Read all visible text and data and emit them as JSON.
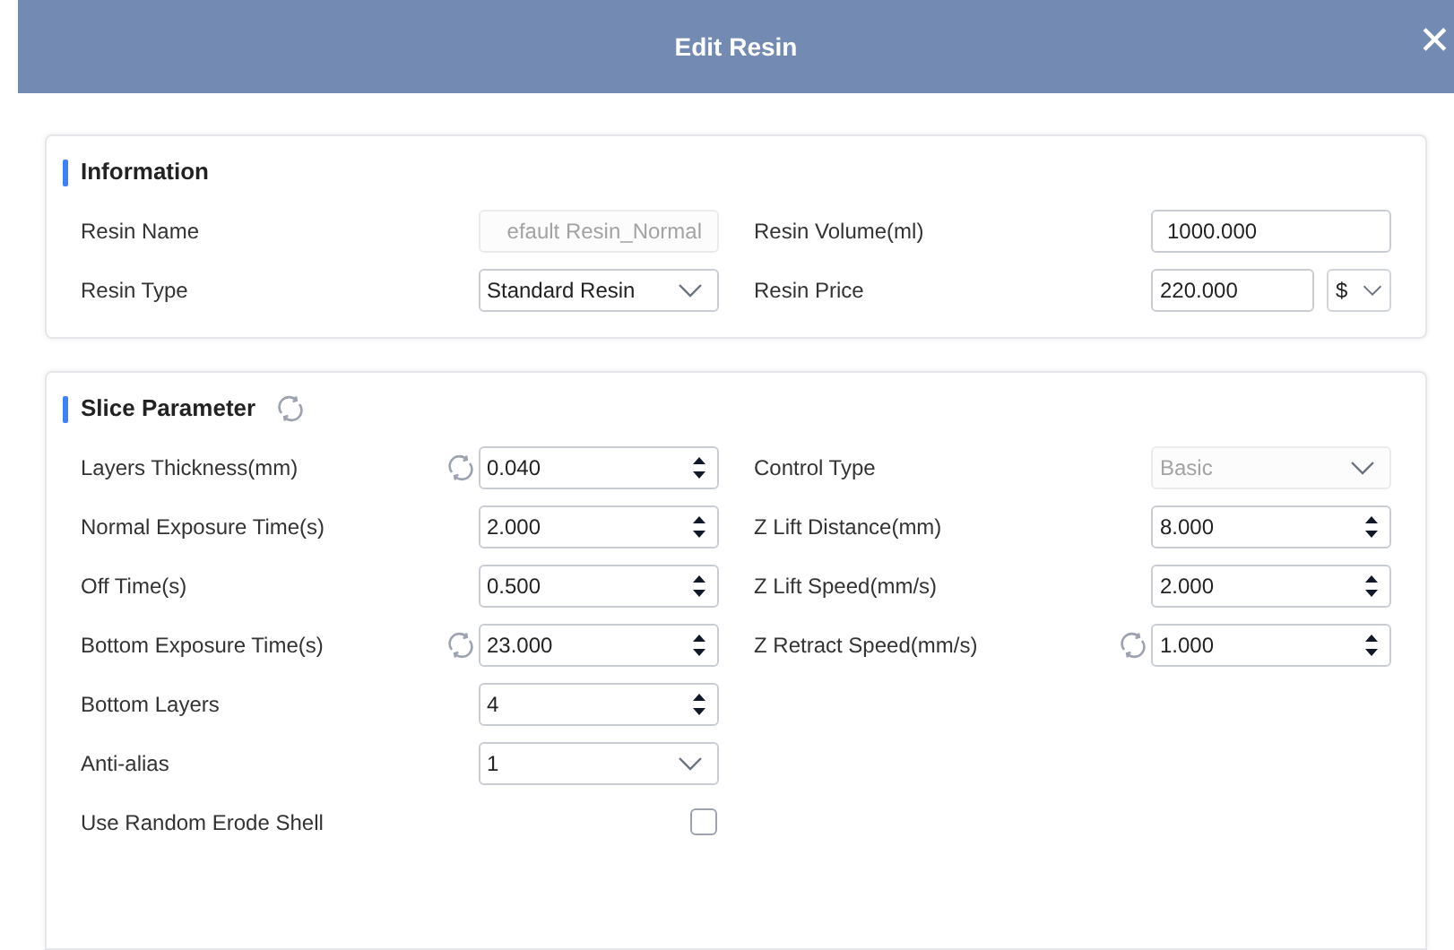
{
  "window": {
    "title": "Edit Resin",
    "close": "✕"
  },
  "sections": [
    {
      "title": "Information",
      "reset": false,
      "left": [
        {
          "label": "Resin Name",
          "kind": "text",
          "value": "efault Resin_Normal",
          "disabled": true,
          "reset": false
        },
        {
          "label": "Resin Type",
          "kind": "select",
          "value": "Standard Resin",
          "disabled": false,
          "reset": false
        }
      ],
      "right": [
        {
          "label": "Resin Volume(ml)",
          "kind": "text",
          "value": "1000.000",
          "disabled": false,
          "reset": false
        },
        {
          "label": "Resin Price",
          "kind": "price",
          "value": "220.000",
          "currency": "$",
          "disabled": false,
          "reset": false
        }
      ]
    },
    {
      "title": "Slice Parameter",
      "reset": true,
      "left": [
        {
          "label": "Layers Thickness(mm)",
          "kind": "spin",
          "value": "0.040",
          "disabled": false,
          "reset": true
        },
        {
          "label": "Normal Exposure Time(s)",
          "kind": "spin",
          "value": "2.000",
          "disabled": false,
          "reset": false
        },
        {
          "label": "Off Time(s)",
          "kind": "spin",
          "value": "0.500",
          "disabled": false,
          "reset": false
        },
        {
          "label": "Bottom Exposure Time(s)",
          "kind": "spin",
          "value": "23.000",
          "disabled": false,
          "reset": true
        },
        {
          "label": "Bottom Layers",
          "kind": "spin",
          "value": "4",
          "disabled": false,
          "reset": false
        },
        {
          "label": "Anti-alias",
          "kind": "select",
          "value": "1",
          "disabled": false,
          "reset": false
        },
        {
          "label": "Use Random Erode Shell",
          "kind": "checkbox",
          "checked": false,
          "disabled": false,
          "reset": false
        }
      ],
      "right": [
        {
          "label": "Control Type",
          "kind": "select",
          "value": "Basic",
          "disabled": true,
          "reset": false
        },
        {
          "label": "Z Lift Distance(mm)",
          "kind": "spin",
          "value": "8.000",
          "disabled": false,
          "reset": false
        },
        {
          "label": "Z Lift Speed(mm/s)",
          "kind": "spin",
          "value": "2.000",
          "disabled": false,
          "reset": false
        },
        {
          "label": "Z Retract Speed(mm/s)",
          "kind": "spin",
          "value": "1.000",
          "disabled": false,
          "reset": true
        }
      ]
    }
  ]
}
